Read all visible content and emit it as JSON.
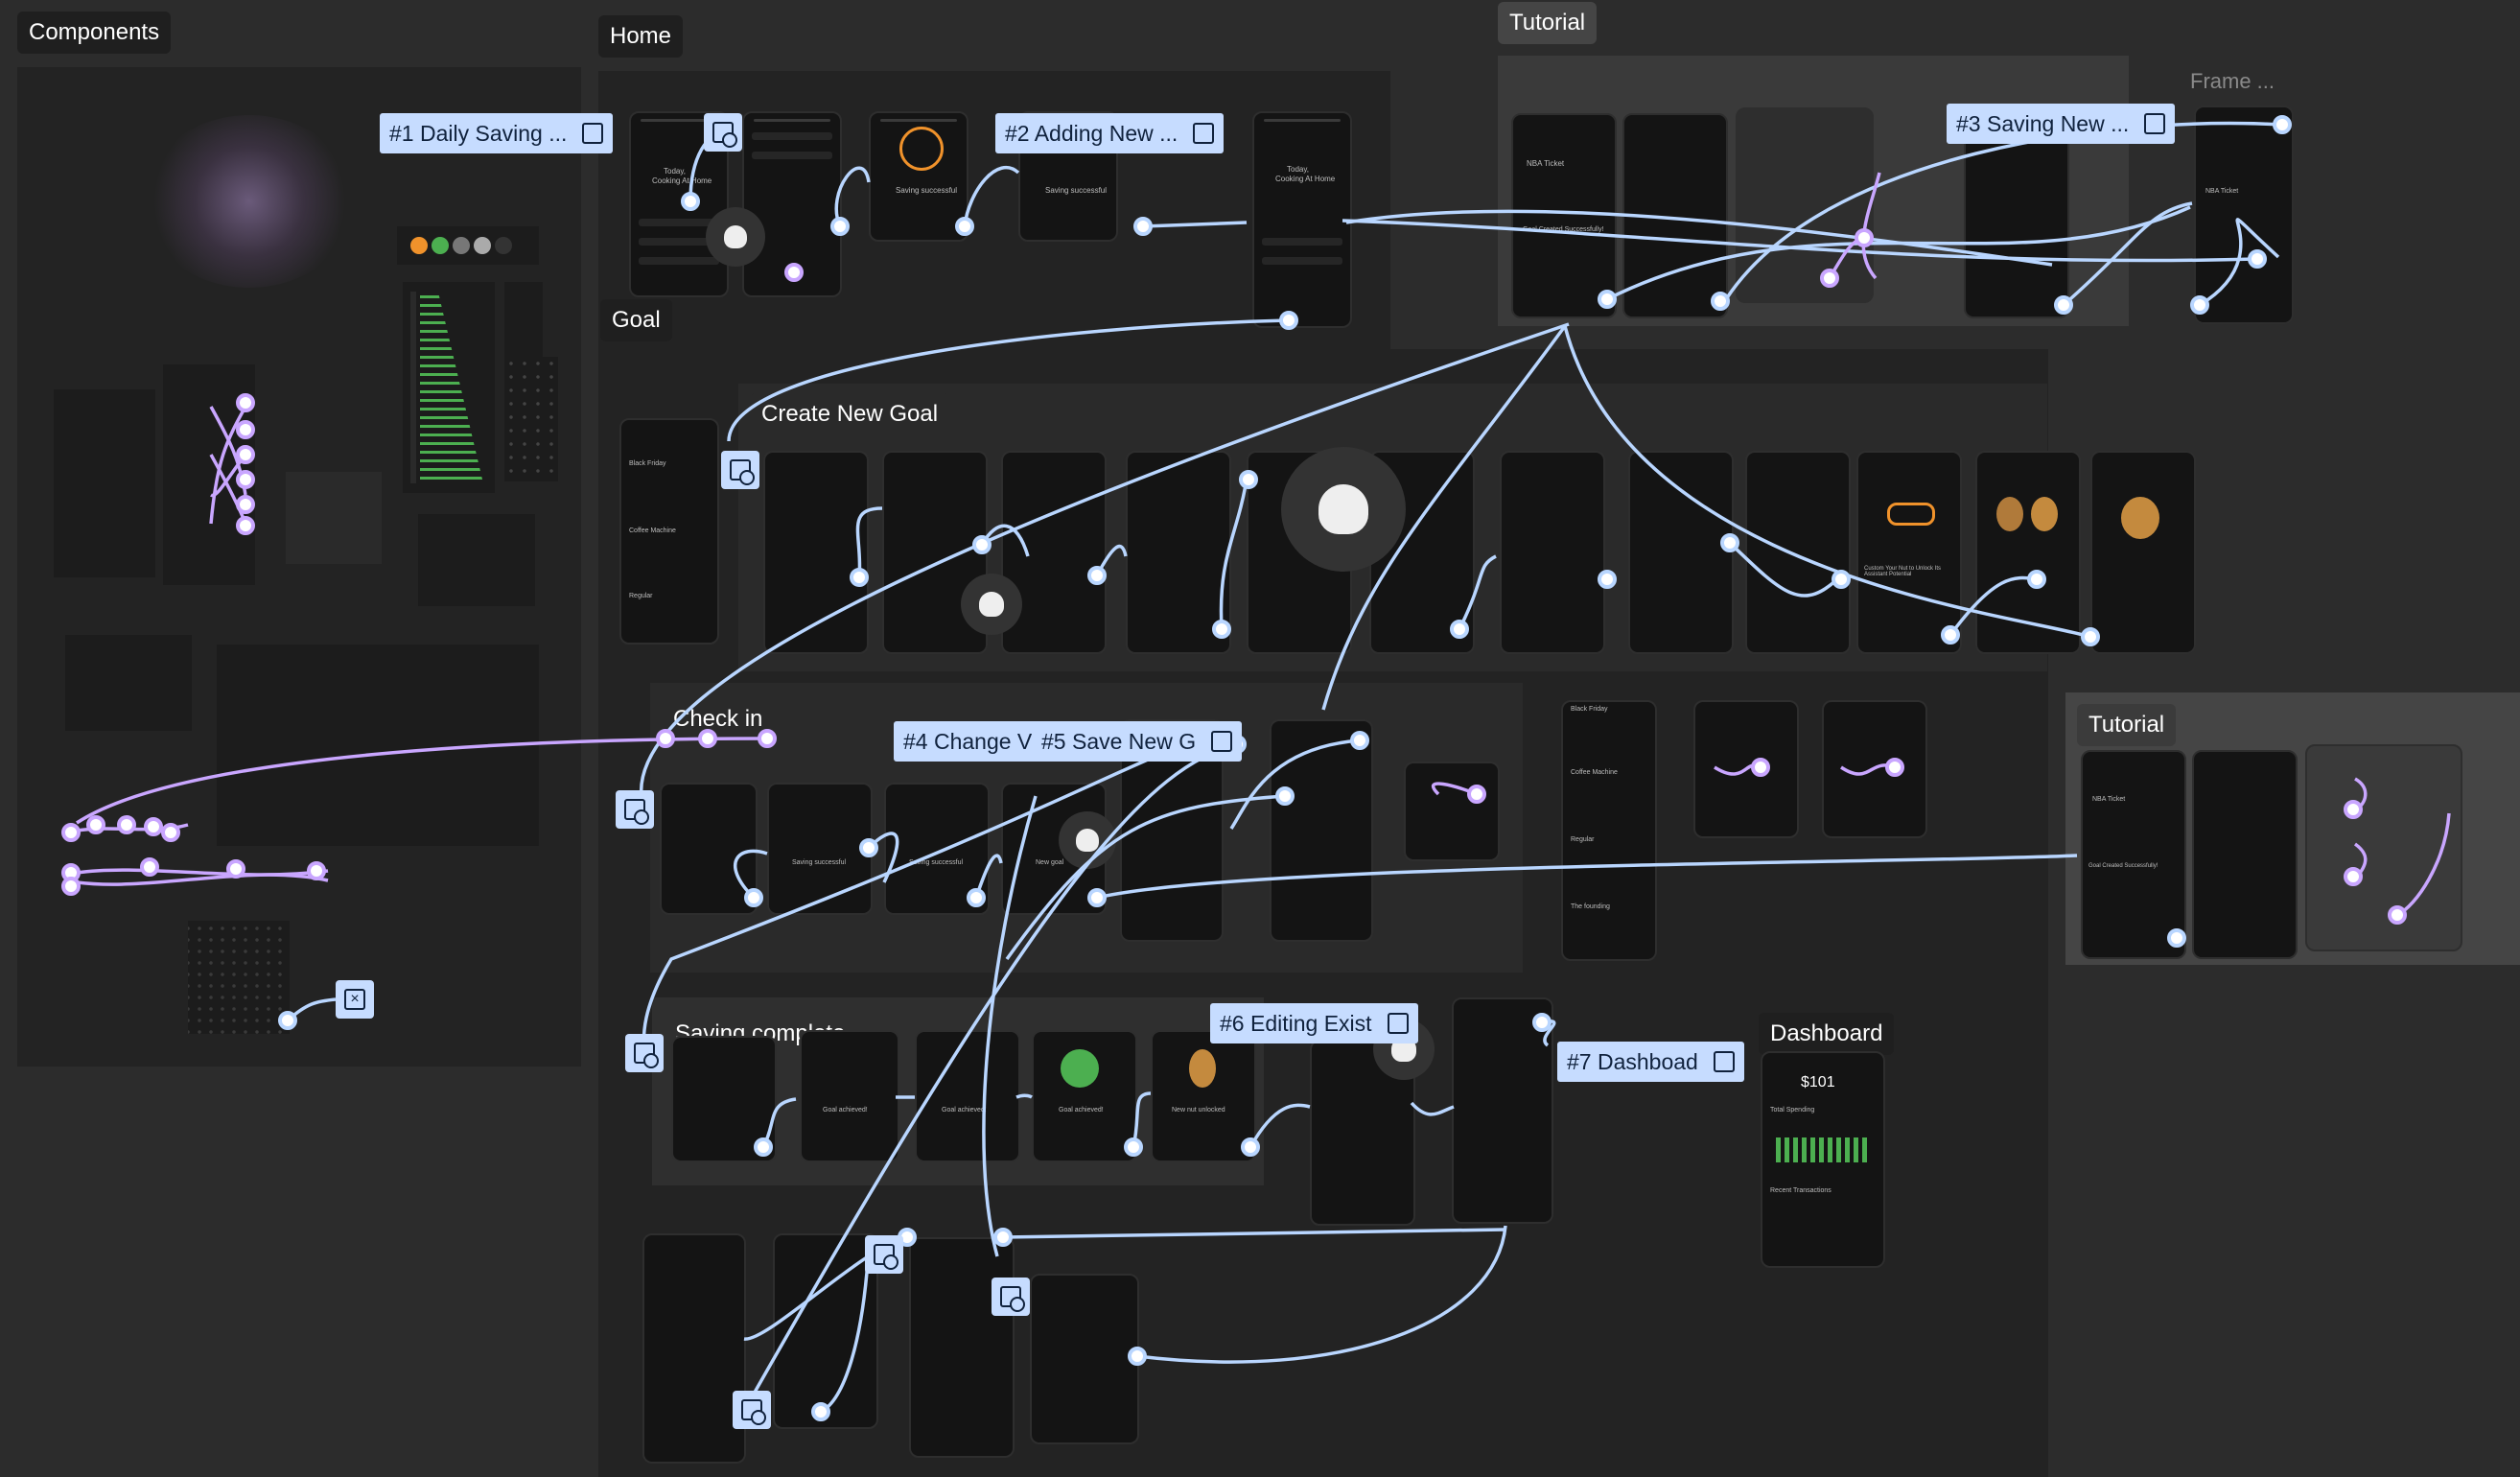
{
  "sections": {
    "components": "Components",
    "home": "Home",
    "tutorial_top": "Tutorial",
    "frame_label": "Frame ...",
    "goal": "Goal",
    "create_new_goal": "Create New Goal",
    "check_in": "Check in",
    "tutorial_right": "Tutorial",
    "saving_complete": "Saving complete",
    "dashboard": "Dashboard"
  },
  "flows": {
    "f1": "#1 Daily Saving ...",
    "f2": "#2 Adding New ...",
    "f3": "#3 Saving New ...",
    "f4": "#4 Change V",
    "f5": "#5 Save New G",
    "f6": "#6 Editing Exist",
    "f7": "#7 Dashboad"
  },
  "screens": {
    "saving_successful": "Saving successful",
    "goal_achieved": "Goal achieved!",
    "new_nut_unlocked": "New nut unlocked",
    "black_friday": "Black Friday",
    "coffee_machine": "Coffee Machine",
    "regular": "Regular",
    "the_founding": "The founding",
    "nba_ticket": "NBA Ticket",
    "goal_created": "Goal Created Successfully!",
    "today": "Today,",
    "cooking_at_home": "Cooking At Home",
    "dashboard_amount": "$101",
    "total_spending": "Total Spending",
    "recent_transactions": "Recent Transactions",
    "custom_nut": "Custom Your Nut to Unlock Its Assistant Potential",
    "new_goal": "New goal"
  },
  "colors": {
    "canvas": "#2c2c2c",
    "section": "#232323",
    "flow_tag": "#c6dcff",
    "connector": "#b9d6ff",
    "connector_alt": "#c9a6ff",
    "accent_orange": "#f0922b",
    "accent_green": "#4caf50"
  }
}
